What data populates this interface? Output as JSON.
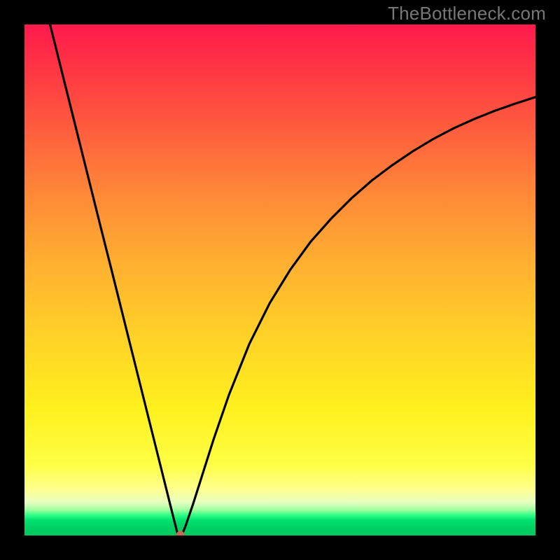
{
  "watermark": "TheBottleneck.com",
  "chart_data": {
    "type": "line",
    "title": "",
    "xlabel": "",
    "ylabel": "",
    "xlim": [
      0,
      1
    ],
    "ylim": [
      0,
      1
    ],
    "grid": false,
    "legend": false,
    "background": "vertical-gradient-red-to-green",
    "border": "black",
    "series": [
      {
        "name": "bottleneck-curve",
        "x": [
          0.05,
          0.07,
          0.09,
          0.11,
          0.13,
          0.15,
          0.17,
          0.19,
          0.21,
          0.23,
          0.25,
          0.27,
          0.29,
          0.295,
          0.3,
          0.305,
          0.31,
          0.315,
          0.33,
          0.35,
          0.37,
          0.4,
          0.44,
          0.48,
          0.52,
          0.56,
          0.6,
          0.64,
          0.68,
          0.72,
          0.76,
          0.8,
          0.84,
          0.88,
          0.92,
          0.96,
          1.0
        ],
        "y": [
          1.0,
          0.92,
          0.84,
          0.76,
          0.68,
          0.6,
          0.521,
          0.441,
          0.361,
          0.281,
          0.201,
          0.121,
          0.041,
          0.021,
          0.002,
          0.001,
          0.006,
          0.018,
          0.062,
          0.125,
          0.188,
          0.275,
          0.375,
          0.455,
          0.52,
          0.575,
          0.62,
          0.66,
          0.695,
          0.725,
          0.752,
          0.776,
          0.797,
          0.815,
          0.831,
          0.845,
          0.858
        ]
      }
    ],
    "annotations": [
      {
        "type": "point",
        "name": "minimum-marker",
        "x": 0.305,
        "y": 0.001,
        "color": "#c46a58"
      }
    ]
  }
}
